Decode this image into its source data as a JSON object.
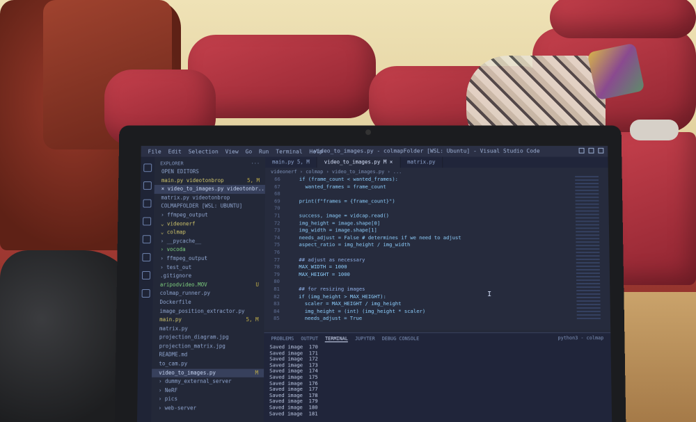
{
  "window": {
    "title": "video_to_images.py - colmapFolder [WSL: Ubuntu] - Visual Studio Code",
    "menu": [
      "File",
      "Edit",
      "Selection",
      "View",
      "Go",
      "Run",
      "Terminal",
      "Help"
    ]
  },
  "sidebar": {
    "header": "EXPLORER",
    "rows": [
      {
        "label": "OPEN EDITORS",
        "badge": "",
        "cls": "head"
      },
      {
        "label": "main.py  videotonbrop",
        "badge": "5, M",
        "cls": "mod"
      },
      {
        "label": "× video_to_images.py  videotonbr...",
        "badge": "M",
        "cls": "sel"
      },
      {
        "label": "matrix.py  videotonbrop",
        "badge": "",
        "cls": ""
      },
      {
        "label": "COLMAPFOLDER [WSL: UBUNTU]",
        "badge": "",
        "cls": "head"
      },
      {
        "label": "› ffmpeg_output",
        "badge": "",
        "cls": ""
      },
      {
        "label": "⌄ videonerf",
        "badge": "",
        "cls": "mod"
      },
      {
        "label": "  ⌄ colmap",
        "badge": "",
        "cls": "mod"
      },
      {
        "label": "    › __pycache__",
        "badge": "",
        "cls": ""
      },
      {
        "label": "    › vocoda",
        "badge": "",
        "cls": "untracked"
      },
      {
        "label": "  › ffmpeg_output",
        "badge": "",
        "cls": ""
      },
      {
        "label": "  › test_out",
        "badge": "",
        "cls": ""
      },
      {
        "label": "  .gitignore",
        "badge": "",
        "cls": ""
      },
      {
        "label": "  aripodvideo.MOV",
        "badge": "U",
        "cls": "untracked"
      },
      {
        "label": "  colmap_runner.py",
        "badge": "",
        "cls": ""
      },
      {
        "label": "  Dockerfile",
        "badge": "",
        "cls": ""
      },
      {
        "label": "  image_position_extractor.py",
        "badge": "",
        "cls": ""
      },
      {
        "label": "  main.py",
        "badge": "5, M",
        "cls": "mod"
      },
      {
        "label": "  matrix.py",
        "badge": "",
        "cls": ""
      },
      {
        "label": "  projection_diagram.jpg",
        "badge": "",
        "cls": ""
      },
      {
        "label": "  projection_matrix.jpg",
        "badge": "",
        "cls": ""
      },
      {
        "label": "  README.md",
        "badge": "",
        "cls": ""
      },
      {
        "label": "  to_cam.py",
        "badge": "",
        "cls": ""
      },
      {
        "label": "  video_to_images.py",
        "badge": "M",
        "cls": "sel"
      },
      {
        "label": "› dummy_external_server",
        "badge": "",
        "cls": ""
      },
      {
        "label": "› NeRF",
        "badge": "",
        "cls": ""
      },
      {
        "label": "› pics",
        "badge": "",
        "cls": ""
      },
      {
        "label": "› web-server",
        "badge": "",
        "cls": ""
      }
    ]
  },
  "editor": {
    "tabs": [
      "main.py 5, M",
      "video_to_images.py M ×",
      "matrix.py"
    ],
    "breadcrumb": "videonerf › colmap › video_to_images.py › ...",
    "lines": [
      {
        "n": "66",
        "t": "    if (frame_count < wanted_frames):"
      },
      {
        "n": "67",
        "t": "      wanted_frames = frame_count"
      },
      {
        "n": "68",
        "t": ""
      },
      {
        "n": "69",
        "t": "    print(f\"frames = {frame_count}\")"
      },
      {
        "n": "70",
        "t": ""
      },
      {
        "n": "71",
        "t": "    success, image = vidcap.read()"
      },
      {
        "n": "72",
        "t": "    img_height = image.shape[0]"
      },
      {
        "n": "73",
        "t": "    img_width = image.shape[1]"
      },
      {
        "n": "74",
        "t": "    needs_adjust = False # determines if we need to adjust"
      },
      {
        "n": "75",
        "t": "    aspect_ratio = img_height / img_width"
      },
      {
        "n": "76",
        "t": ""
      },
      {
        "n": "77",
        "t": "    ## adjust as necessary"
      },
      {
        "n": "78",
        "t": "    MAX_WIDTH = 1000"
      },
      {
        "n": "79",
        "t": "    MAX_HEIGHT = 1000"
      },
      {
        "n": "80",
        "t": ""
      },
      {
        "n": "81",
        "t": "    ## for resizing images"
      },
      {
        "n": "82",
        "t": "    if (img_height > MAX_HEIGHT):"
      },
      {
        "n": "83",
        "t": "      scaler = MAX_HEIGHT / img_height"
      },
      {
        "n": "84",
        "t": "      img_height = (int) (img_height * scaler)"
      },
      {
        "n": "85",
        "t": "      needs_adjust = True"
      }
    ]
  },
  "panel": {
    "tabs": [
      "PROBLEMS",
      "OUTPUT",
      "TERMINAL",
      "JUPYTER",
      "DEBUG CONSOLE"
    ],
    "active_tab": "TERMINAL",
    "right_label": "python3 - colmap",
    "terminal_lines": [
      "Saved image  170",
      "Saved image  171",
      "Saved image  172",
      "Saved image  173",
      "Saved image  174",
      "Saved image  175",
      "Saved image  176",
      "Saved image  177",
      "Saved image  178",
      "Saved image  179",
      "Saved image  180",
      "Saved image  181"
    ]
  }
}
